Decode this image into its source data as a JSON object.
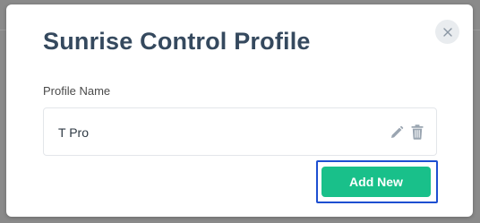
{
  "modal": {
    "title": "Sunrise Control Profile",
    "close_icon": "close-icon",
    "field_label": "Profile Name",
    "profiles": [
      {
        "name": "T Pro",
        "actions": [
          "edit-icon",
          "trash-icon"
        ]
      }
    ],
    "add_button_label": "Add New"
  },
  "colors": {
    "title": "#35495e",
    "accent": "#19c08a",
    "focus_ring": "#1d4fd1",
    "icon": "#9aa5b1"
  }
}
